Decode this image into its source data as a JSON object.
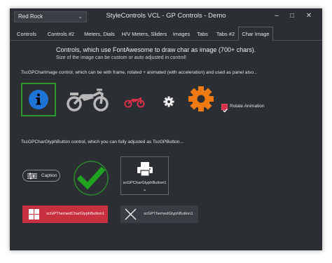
{
  "titlebar": {
    "style_combo": "Red Rock",
    "title": "StyleControls VCL - GP Controls - Demo"
  },
  "tabs": [
    {
      "label": "Controls"
    },
    {
      "label": "Controls #2"
    },
    {
      "label": "Meters, Dials"
    },
    {
      "label": "H/V Meters, Sliders"
    },
    {
      "label": "Images"
    },
    {
      "label": "Tabs"
    },
    {
      "label": "Tabs #2"
    },
    {
      "label": "Char Image"
    }
  ],
  "active_tab": "Char Image",
  "content": {
    "heading": "Controls, which use FontAwesome to draw char as image (700+ chars).",
    "subheading": "Size of the image can be custom or auto adjusted in control!",
    "char_image_label": "TscGPCharImage control, which can be with frame, rotated + animated (with acceleration) and used as panel also...",
    "rotate_checkbox": {
      "label": "Rotate Animation",
      "checked": true
    },
    "glyph_button_label": "TscGPCharGlyphButton control, which you can fully adjusted as TscGPButton...",
    "caption_button": "Caption",
    "glyph_button": "scGPCharGlyphButton1",
    "themed_button_red": "scGPThemedCharGlyphButton1",
    "themed_button_dark": "scGPThemedGlyphButton1"
  },
  "colors": {
    "window_bg": "#2b2e33",
    "accent_red": "#c9303f",
    "info_blue": "#1e73d6",
    "frame_green": "#2a9a2e",
    "gear_orange": "#f07a12",
    "check_green": "#21a321"
  },
  "icons": {
    "info": "info-circle-icon",
    "motorcycle_large": "motorcycle-icon",
    "motorcycle_small": "motorcycle-icon",
    "gear_small": "gear-icon",
    "gear_large": "gear-icon",
    "sliders": "sliders-icon",
    "checkmark": "check-icon",
    "printer": "printer-icon",
    "windows": "windows-logo-icon",
    "close": "close-icon"
  }
}
